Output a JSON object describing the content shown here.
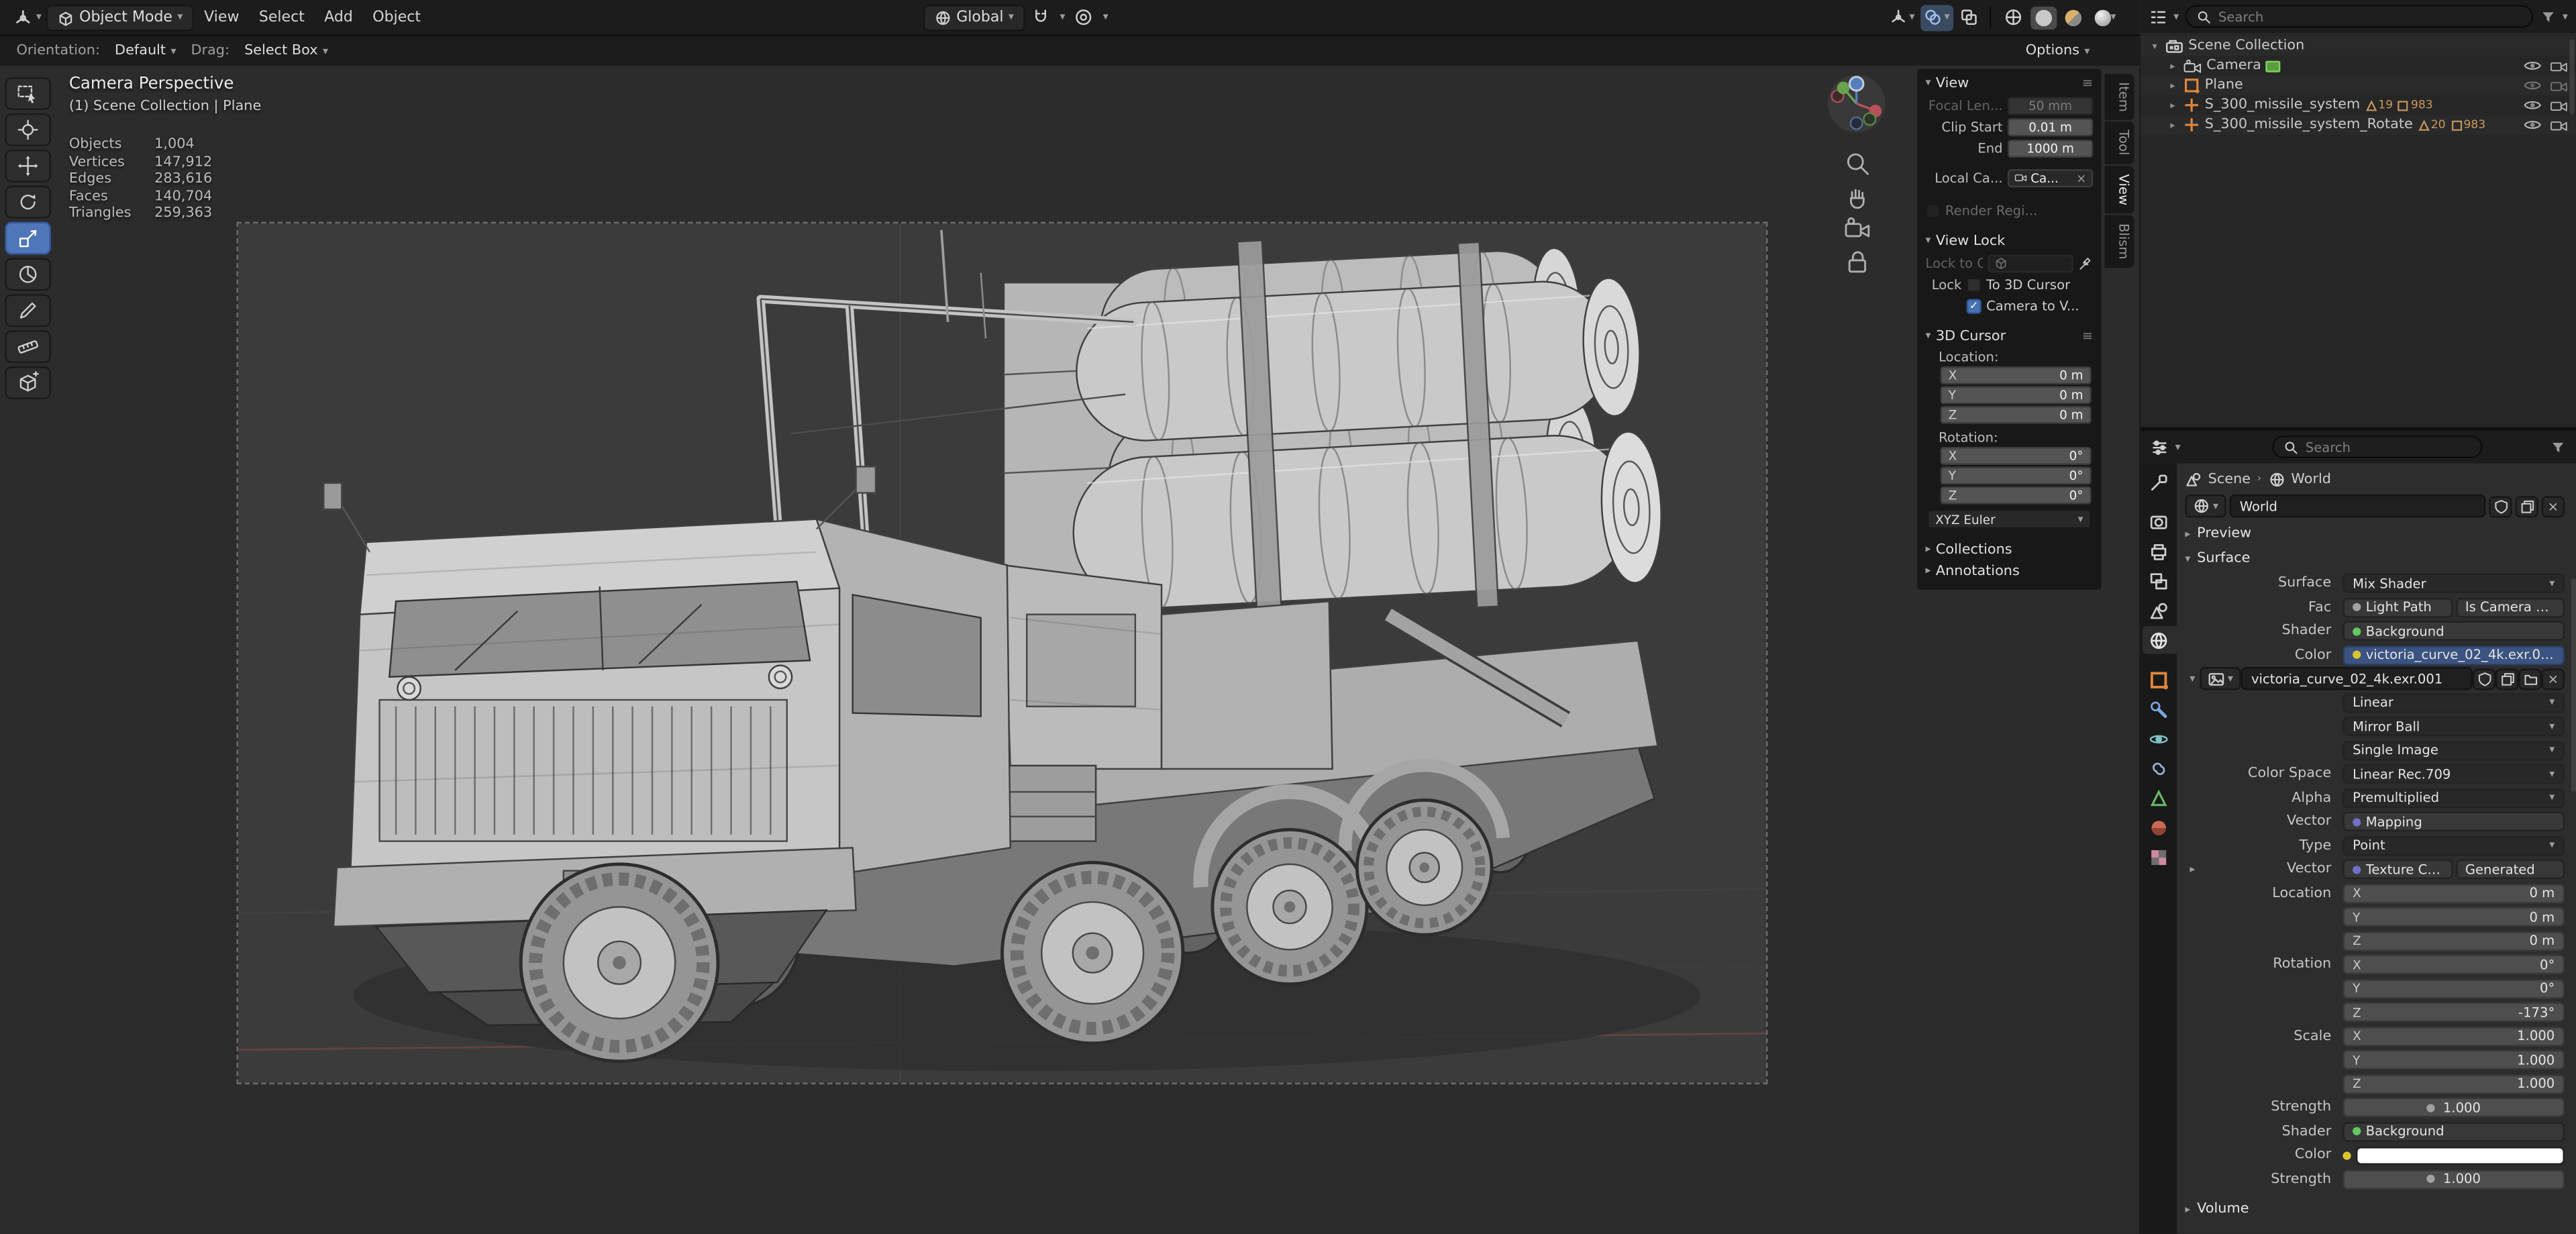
{
  "icons": {
    "chevron_down": "▾",
    "chevron_right": "▸",
    "menu": "≡",
    "close": "×",
    "check": "✓",
    "breadcrumb_sep": "›"
  },
  "header": {
    "mode_label": "Object Mode",
    "menus": [
      {
        "label": "View"
      },
      {
        "label": "Select"
      },
      {
        "label": "Add"
      },
      {
        "label": "Object"
      }
    ],
    "orientation_value": "Global",
    "options_label": "Options"
  },
  "tool_settings": {
    "orientation_label": "Orientation:",
    "orientation_value": "Default",
    "drag_label": "Drag:",
    "drag_value": "Select Box"
  },
  "viewport_overlay": {
    "view_title": "Camera Perspective",
    "context": "(1) Scene Collection | Plane",
    "stats": [
      {
        "label": "Objects",
        "value": "1,004"
      },
      {
        "label": "Vertices",
        "value": "147,912"
      },
      {
        "label": "Edges",
        "value": "283,616"
      },
      {
        "label": "Faces",
        "value": "140,704"
      },
      {
        "label": "Triangles",
        "value": "259,363"
      }
    ]
  },
  "sidebar": {
    "tabs": [
      {
        "label": "Item"
      },
      {
        "label": "Tool"
      },
      {
        "label": "View"
      },
      {
        "label": "Blism"
      }
    ],
    "view": {
      "title": "View",
      "focal_label": "Focal Len...",
      "focal_value": "50 mm",
      "clip_start_label": "Clip Start",
      "clip_start_value": "0.01 m",
      "end_label": "End",
      "end_value": "1000 m",
      "local_camera_label": "Local Ca...",
      "local_camera_value": "Ca...",
      "render_region_label": "Render Regi..."
    },
    "view_lock": {
      "title": "View Lock",
      "lock_to_object_label": "Lock to O...",
      "lock_label": "Lock",
      "to_3d_cursor_label": "To 3D Cursor",
      "camera_to_view_label": "Camera to V..."
    },
    "cursor": {
      "title": "3D Cursor",
      "location_label": "Location:",
      "location": [
        {
          "axis": "X",
          "value": "0 m"
        },
        {
          "axis": "Y",
          "value": "0 m"
        },
        {
          "axis": "Z",
          "value": "0 m"
        }
      ],
      "rotation_label": "Rotation:",
      "rotation": [
        {
          "axis": "X",
          "value": "0°"
        },
        {
          "axis": "Y",
          "value": "0°"
        },
        {
          "axis": "Z",
          "value": "0°"
        }
      ],
      "rotation_mode": "XYZ Euler"
    },
    "collections_title": "Collections",
    "annotations_title": "Annotations"
  },
  "outliner": {
    "search_placeholder": "Search",
    "root_label": "Scene Collection",
    "items": [
      {
        "label": "Camera"
      },
      {
        "label": "Plane"
      },
      {
        "label": "S_300_missile_system",
        "badge_a": "19",
        "badge_b": "983"
      },
      {
        "label": "S_300_missile_system_Rotate",
        "badge_a": "20",
        "badge_b": "983"
      }
    ]
  },
  "properties": {
    "search_placeholder": "Search",
    "breadcrumb_scene": "Scene",
    "breadcrumb_world": "World",
    "datablock_name": "World",
    "preview_title": "Preview",
    "surface_title": "Surface",
    "volume_title": "Volume",
    "rows": {
      "surface_label": "Surface",
      "surface_value": "Mix Shader",
      "fac_label": "Fac",
      "fac_value_a": "Light Path",
      "fac_value_b": "Is Camera Ray",
      "shader_label": "Shader",
      "shader_value": "Background",
      "color_label": "Color",
      "color_value": "victoria_curve_02_4k.exr.001",
      "image_name": "victoria_curve_02_4k.exr.001",
      "interpolation_value": "Linear",
      "projection_value": "Mirror Ball",
      "source_value": "Single Image",
      "color_space_label": "Color Space",
      "color_space_value": "Linear Rec.709",
      "alpha_label": "Alpha",
      "alpha_value": "Premultiplied",
      "vector_label": "Vector",
      "vector_value": "Mapping",
      "type_label": "Type",
      "type_value": "Point",
      "vector2_label": "Vector",
      "vector2_value_a": "Texture Coordinate",
      "vector2_value_b": "Generated",
      "location_label": "Location",
      "location": [
        {
          "axis": "X",
          "value": "0 m"
        },
        {
          "axis": "Y",
          "value": "0 m"
        },
        {
          "axis": "Z",
          "value": "0 m"
        }
      ],
      "rotation_label": "Rotation",
      "rotation": [
        {
          "axis": "X",
          "value": "0°"
        },
        {
          "axis": "Y",
          "value": "0°"
        },
        {
          "axis": "Z",
          "value": "-173°"
        }
      ],
      "scale_label": "Scale",
      "scale": [
        {
          "axis": "X",
          "value": "1.000"
        },
        {
          "axis": "Y",
          "value": "1.000"
        },
        {
          "axis": "Z",
          "value": "1.000"
        }
      ],
      "strength_label": "Strength",
      "strength_value": "1.000",
      "shader2_label": "Shader",
      "shader2_value": "Background",
      "color2_label": "Color",
      "strength2_label": "Strength",
      "strength2_value": "1.000"
    }
  }
}
